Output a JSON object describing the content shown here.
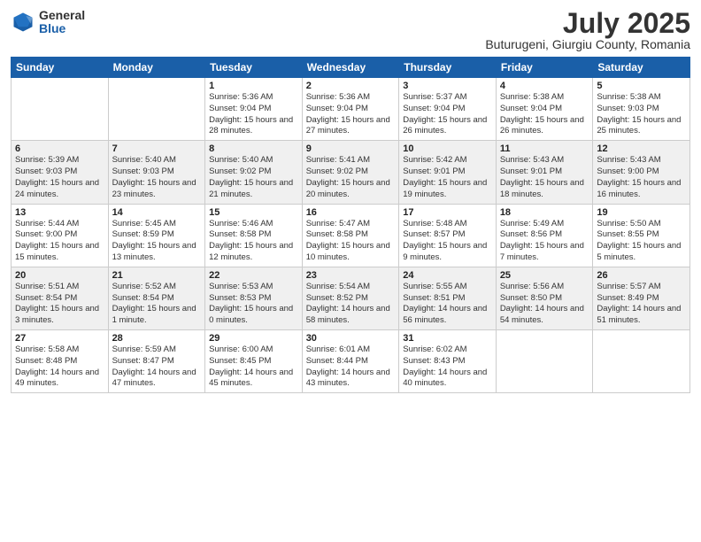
{
  "logo": {
    "general": "General",
    "blue": "Blue"
  },
  "title": "July 2025",
  "location": "Buturugeni, Giurgiu County, Romania",
  "weekdays": [
    "Sunday",
    "Monday",
    "Tuesday",
    "Wednesday",
    "Thursday",
    "Friday",
    "Saturday"
  ],
  "weeks": [
    [
      {
        "day": "",
        "info": ""
      },
      {
        "day": "",
        "info": ""
      },
      {
        "day": "1",
        "info": "Sunrise: 5:36 AM\nSunset: 9:04 PM\nDaylight: 15 hours\nand 28 minutes."
      },
      {
        "day": "2",
        "info": "Sunrise: 5:36 AM\nSunset: 9:04 PM\nDaylight: 15 hours\nand 27 minutes."
      },
      {
        "day": "3",
        "info": "Sunrise: 5:37 AM\nSunset: 9:04 PM\nDaylight: 15 hours\nand 26 minutes."
      },
      {
        "day": "4",
        "info": "Sunrise: 5:38 AM\nSunset: 9:04 PM\nDaylight: 15 hours\nand 26 minutes."
      },
      {
        "day": "5",
        "info": "Sunrise: 5:38 AM\nSunset: 9:03 PM\nDaylight: 15 hours\nand 25 minutes."
      }
    ],
    [
      {
        "day": "6",
        "info": "Sunrise: 5:39 AM\nSunset: 9:03 PM\nDaylight: 15 hours\nand 24 minutes."
      },
      {
        "day": "7",
        "info": "Sunrise: 5:40 AM\nSunset: 9:03 PM\nDaylight: 15 hours\nand 23 minutes."
      },
      {
        "day": "8",
        "info": "Sunrise: 5:40 AM\nSunset: 9:02 PM\nDaylight: 15 hours\nand 21 minutes."
      },
      {
        "day": "9",
        "info": "Sunrise: 5:41 AM\nSunset: 9:02 PM\nDaylight: 15 hours\nand 20 minutes."
      },
      {
        "day": "10",
        "info": "Sunrise: 5:42 AM\nSunset: 9:01 PM\nDaylight: 15 hours\nand 19 minutes."
      },
      {
        "day": "11",
        "info": "Sunrise: 5:43 AM\nSunset: 9:01 PM\nDaylight: 15 hours\nand 18 minutes."
      },
      {
        "day": "12",
        "info": "Sunrise: 5:43 AM\nSunset: 9:00 PM\nDaylight: 15 hours\nand 16 minutes."
      }
    ],
    [
      {
        "day": "13",
        "info": "Sunrise: 5:44 AM\nSunset: 9:00 PM\nDaylight: 15 hours\nand 15 minutes."
      },
      {
        "day": "14",
        "info": "Sunrise: 5:45 AM\nSunset: 8:59 PM\nDaylight: 15 hours\nand 13 minutes."
      },
      {
        "day": "15",
        "info": "Sunrise: 5:46 AM\nSunset: 8:58 PM\nDaylight: 15 hours\nand 12 minutes."
      },
      {
        "day": "16",
        "info": "Sunrise: 5:47 AM\nSunset: 8:58 PM\nDaylight: 15 hours\nand 10 minutes."
      },
      {
        "day": "17",
        "info": "Sunrise: 5:48 AM\nSunset: 8:57 PM\nDaylight: 15 hours\nand 9 minutes."
      },
      {
        "day": "18",
        "info": "Sunrise: 5:49 AM\nSunset: 8:56 PM\nDaylight: 15 hours\nand 7 minutes."
      },
      {
        "day": "19",
        "info": "Sunrise: 5:50 AM\nSunset: 8:55 PM\nDaylight: 15 hours\nand 5 minutes."
      }
    ],
    [
      {
        "day": "20",
        "info": "Sunrise: 5:51 AM\nSunset: 8:54 PM\nDaylight: 15 hours\nand 3 minutes."
      },
      {
        "day": "21",
        "info": "Sunrise: 5:52 AM\nSunset: 8:54 PM\nDaylight: 15 hours\nand 1 minute."
      },
      {
        "day": "22",
        "info": "Sunrise: 5:53 AM\nSunset: 8:53 PM\nDaylight: 15 hours\nand 0 minutes."
      },
      {
        "day": "23",
        "info": "Sunrise: 5:54 AM\nSunset: 8:52 PM\nDaylight: 14 hours\nand 58 minutes."
      },
      {
        "day": "24",
        "info": "Sunrise: 5:55 AM\nSunset: 8:51 PM\nDaylight: 14 hours\nand 56 minutes."
      },
      {
        "day": "25",
        "info": "Sunrise: 5:56 AM\nSunset: 8:50 PM\nDaylight: 14 hours\nand 54 minutes."
      },
      {
        "day": "26",
        "info": "Sunrise: 5:57 AM\nSunset: 8:49 PM\nDaylight: 14 hours\nand 51 minutes."
      }
    ],
    [
      {
        "day": "27",
        "info": "Sunrise: 5:58 AM\nSunset: 8:48 PM\nDaylight: 14 hours\nand 49 minutes."
      },
      {
        "day": "28",
        "info": "Sunrise: 5:59 AM\nSunset: 8:47 PM\nDaylight: 14 hours\nand 47 minutes."
      },
      {
        "day": "29",
        "info": "Sunrise: 6:00 AM\nSunset: 8:45 PM\nDaylight: 14 hours\nand 45 minutes."
      },
      {
        "day": "30",
        "info": "Sunrise: 6:01 AM\nSunset: 8:44 PM\nDaylight: 14 hours\nand 43 minutes."
      },
      {
        "day": "31",
        "info": "Sunrise: 6:02 AM\nSunset: 8:43 PM\nDaylight: 14 hours\nand 40 minutes."
      },
      {
        "day": "",
        "info": ""
      },
      {
        "day": "",
        "info": ""
      }
    ]
  ]
}
